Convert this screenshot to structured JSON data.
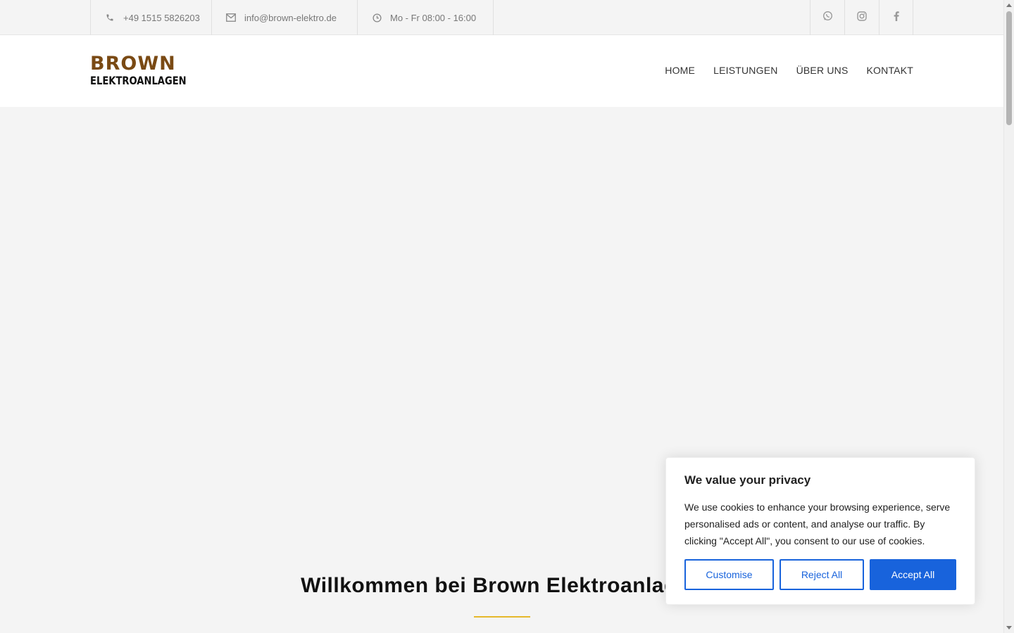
{
  "topbar": {
    "phone": "+49 1515 5826203",
    "email": "info@brown-elektro.de",
    "hours": "Mo - Fr 08:00 - 16:00",
    "social_icons": [
      "whatsapp-icon",
      "instagram-icon",
      "facebook-icon"
    ]
  },
  "header": {
    "logo_line1": "BROWN",
    "logo_line2": "ELEKTROANLAGEN",
    "nav": [
      {
        "label": "HOME"
      },
      {
        "label": "LEISTUNGEN"
      },
      {
        "label": "ÜBER UNS"
      },
      {
        "label": "KONTAKT"
      }
    ]
  },
  "hero": {
    "title": "Willkommen bei Brown Elektroanlagen",
    "accent_color": "#e5b82a"
  },
  "cookie": {
    "title": "We value your privacy",
    "text": "We use cookies to enhance your browsing experience, serve personalised ads or content, and analyse our traffic. By clicking \"Accept All\", you consent to our use of cookies.",
    "customise": "Customise",
    "reject": "Reject All",
    "accept": "Accept All",
    "accent_color": "#1863dc"
  },
  "colors": {
    "brand_brown": "#7a4a14",
    "background": "#f4f4f4"
  }
}
